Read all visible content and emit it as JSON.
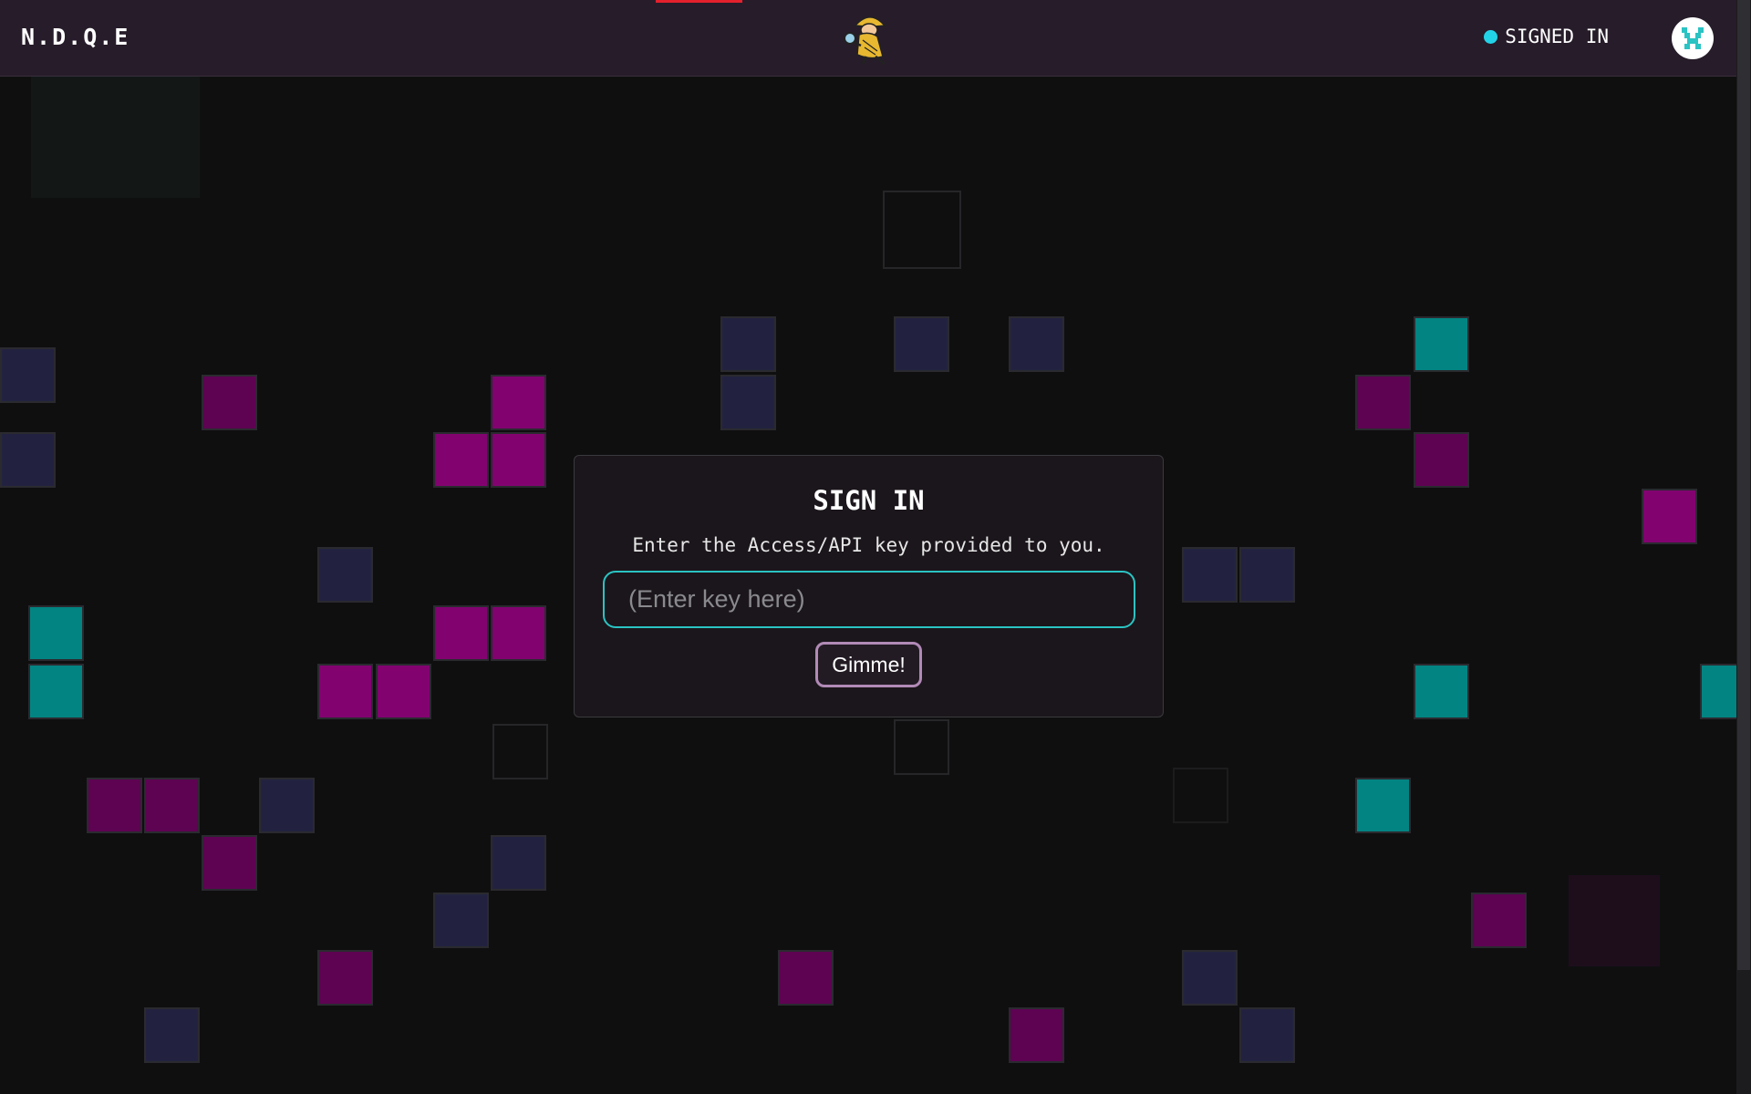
{
  "header": {
    "brand": "N.D.Q.E",
    "mascot_icon": "detective-mascot-icon",
    "status_label": "SIGNED IN",
    "status_color": "#22d3e8",
    "avatar_icon": "pixel-avatar-icon",
    "background": "#271c2a",
    "loading_bar_color": "#e4202c"
  },
  "modal": {
    "title": "SIGN IN",
    "subtitle": "Enter the Access/API key provided to you.",
    "input_placeholder": "(Enter key here)",
    "input_value": "",
    "button_label": "Gimme!"
  },
  "colors": {
    "page_background": "#0f0f10",
    "tile_magenta": "#820370",
    "tile_magenta_dark": "#5e0352",
    "tile_teal": "#028482",
    "tile_navy": "#222240",
    "input_border": "#2bc3c3",
    "button_border": "#b18ab6"
  }
}
